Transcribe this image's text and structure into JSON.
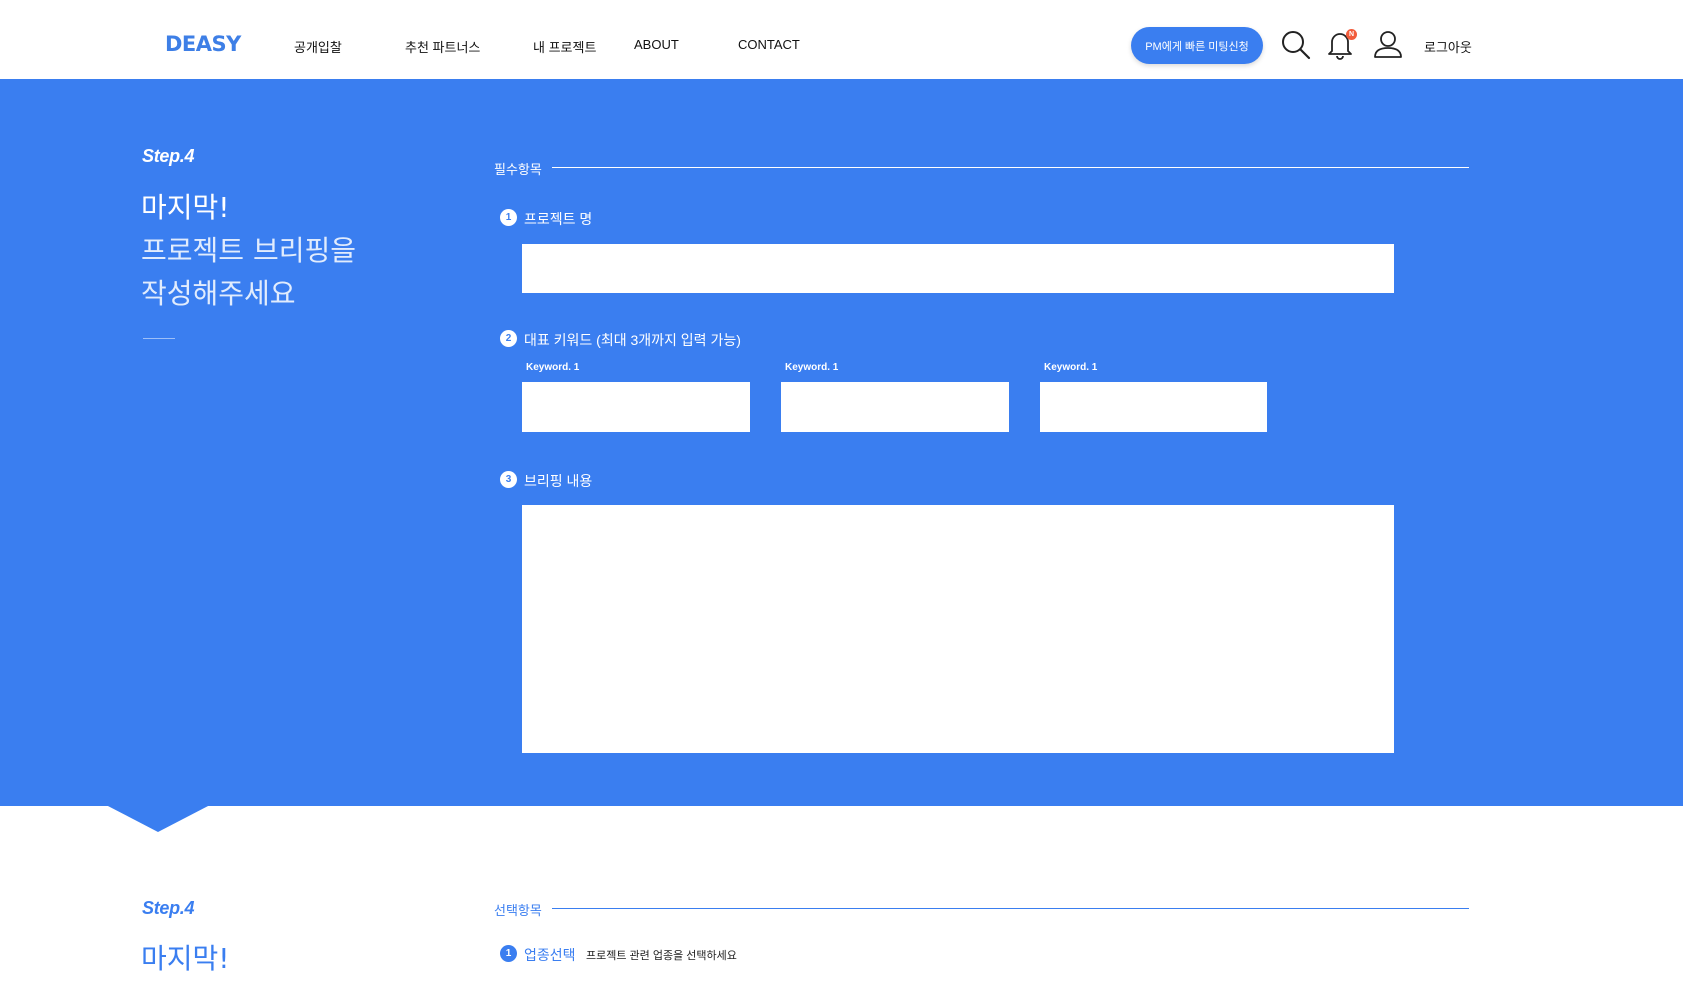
{
  "header": {
    "logo": "DEASY",
    "nav": [
      "공개입찰",
      "추천 파트너스",
      "내 프로젝트",
      "ABOUT",
      "CONTACT"
    ],
    "pm_button": "PM에게 빠른 미팅신청",
    "notification_badge": "N",
    "logout": "로그아웃"
  },
  "required_section": {
    "step": "Step.4",
    "heading_lines": [
      "마지막!",
      "프로젝트 브리핑을",
      "작성해주세요"
    ],
    "title": "필수항목",
    "q1": {
      "num": "1",
      "label": "프로젝트 명",
      "value": ""
    },
    "q2": {
      "num": "2",
      "label": "대표 키워드 (최대 3개까지 입력 가능)",
      "keywords": [
        {
          "label": "Keyword. 1",
          "value": ""
        },
        {
          "label": "Keyword. 1",
          "value": ""
        },
        {
          "label": "Keyword. 1",
          "value": ""
        }
      ]
    },
    "q3": {
      "num": "3",
      "label": "브리핑 내용",
      "value": ""
    }
  },
  "optional_section": {
    "step": "Step.4",
    "heading": "마지막!",
    "title": "선택항목",
    "q1": {
      "num": "1",
      "label": "업종선택",
      "hint": "프로젝트 관련 업종을 선택하세요"
    }
  },
  "colors": {
    "brand_blue": "#3a7ef0",
    "badge": "#f25c3b"
  }
}
